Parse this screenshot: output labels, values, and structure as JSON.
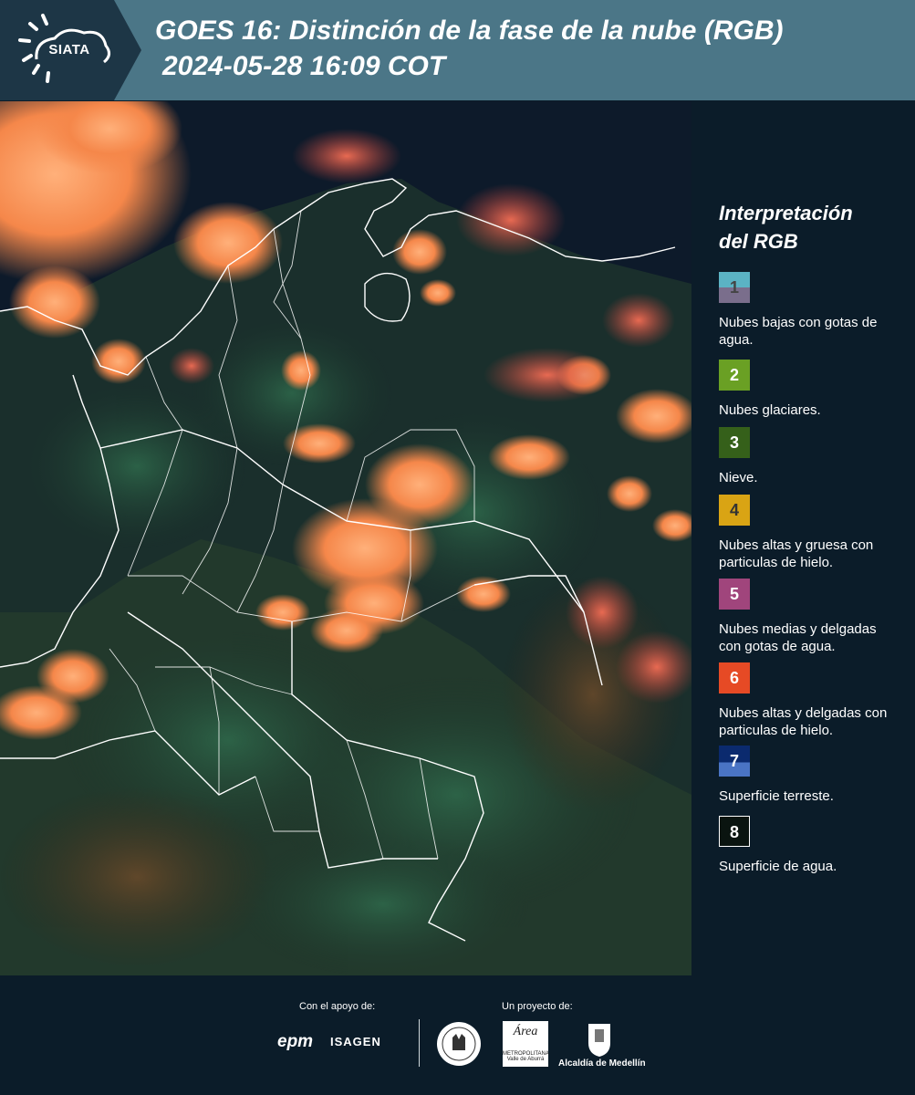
{
  "header": {
    "logo_text": "SIATA",
    "title": "GOES 16: Distinción de la fase de la nube (RGB)",
    "subtitle": "2024-05-28 16:09 COT"
  },
  "legend": {
    "title_line1": "Interpretación",
    "title_line2": "del RGB",
    "items": [
      {
        "number": "1",
        "label": "Nubes bajas con gotas de agua.",
        "color_top": "#5bb3c4",
        "color_bottom": "#7a6e8c"
      },
      {
        "number": "2",
        "label": "Nubes glaciares.",
        "color": "#6aa024"
      },
      {
        "number": "3",
        "label": "Nieve.",
        "color": "#35601a"
      },
      {
        "number": "4",
        "label": "Nubes altas y gruesa con particulas de hielo.",
        "color": "#d9a414"
      },
      {
        "number": "5",
        "label": "Nubes medias y delgadas con gotas de agua.",
        "color": "#a0457c"
      },
      {
        "number": "6",
        "label": "Nubes altas y delgadas con particulas de hielo.",
        "color": "#e64a25"
      },
      {
        "number": "7",
        "label": "Superficie terreste.",
        "color_top": "#0b2a6e",
        "color_bottom": "#4a74c4"
      },
      {
        "number": "8",
        "label": "Superficie de agua.",
        "color": "#0a1410"
      }
    ]
  },
  "footer": {
    "support_label": "Con el apoyo de:",
    "project_label": "Un proyecto de:",
    "sponsor1": "epm",
    "sponsor2": "ISAGEN",
    "area_logo": "Área",
    "area_sub": "METROPOLITANA Valle de Aburrá",
    "medellin": "Alcaldía de Medellín"
  },
  "colors": {
    "header_bg": "#4b7687",
    "page_bg": "#0b1c29",
    "cloud_orange": "#f5874a",
    "land_dark": "#1e3a2e",
    "ocean": "#0d1a2a"
  }
}
